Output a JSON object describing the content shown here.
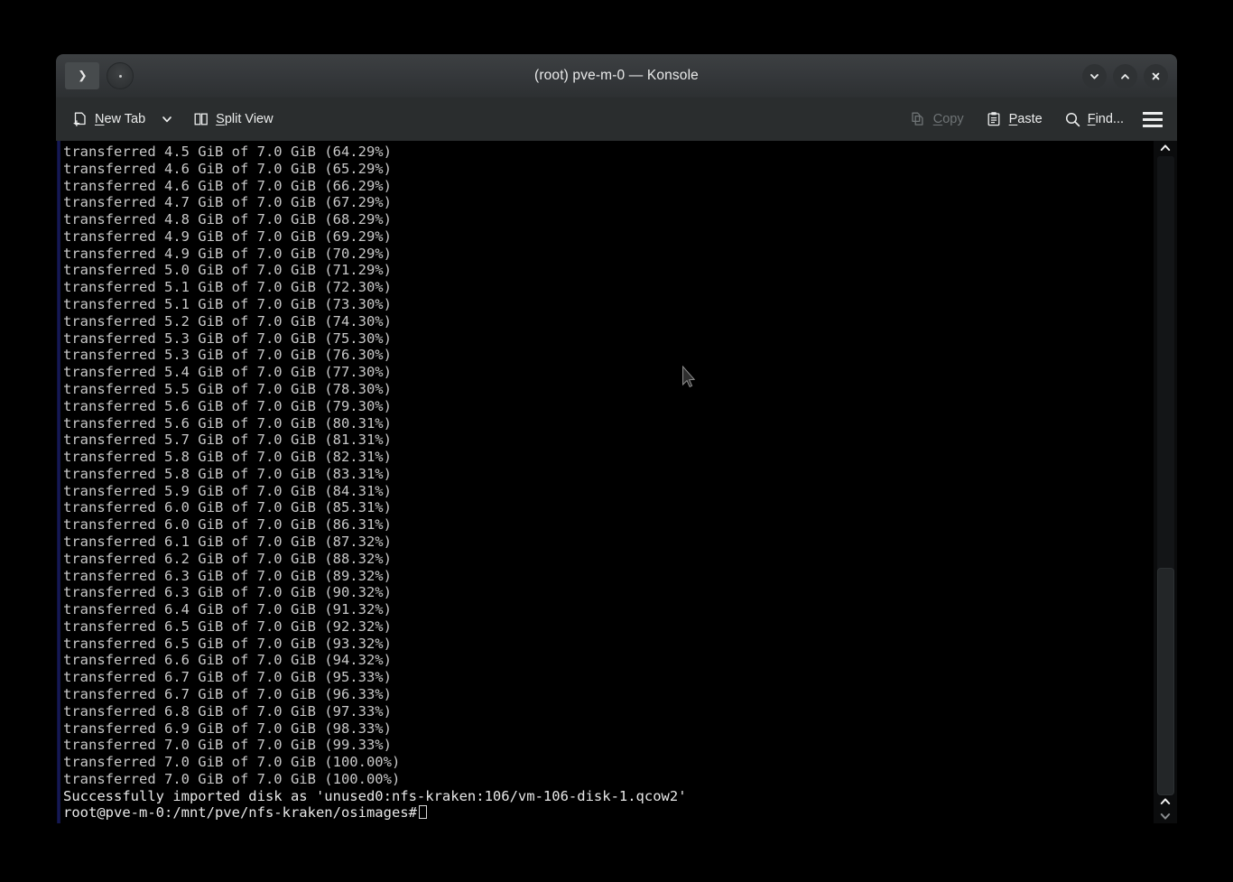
{
  "window": {
    "title": "(root) pve-m-0 — Konsole",
    "tab_icon": "terminal-prompt-icon",
    "new_tab_circle_icon": "new-tab-circle-icon",
    "controls": {
      "minimize": "chevron-down-icon",
      "maximize": "chevron-up-icon",
      "close": "close-icon"
    }
  },
  "toolbar": {
    "new_tab": {
      "label_pre": "",
      "label_u": "N",
      "label_post": "ew Tab",
      "icon": "new-tab-icon",
      "caret": "chevron-down-icon"
    },
    "split_view": {
      "label_u": "S",
      "label_post": "plit View",
      "icon": "split-view-icon"
    },
    "copy": {
      "label_u": "C",
      "label_post": "opy",
      "icon": "copy-icon",
      "disabled": true
    },
    "paste": {
      "label_u": "P",
      "label_post": "aste",
      "icon": "paste-icon",
      "disabled": false
    },
    "find": {
      "label_u": "F",
      "label_post": "ind...",
      "icon": "search-icon",
      "disabled": false
    },
    "menu": {
      "icon": "hamburger-menu-icon"
    }
  },
  "terminal": {
    "prompt": "root@pve-m-0:/mnt/pve/nfs-kraken/osimages#",
    "cursor": "block-cursor",
    "lines": [
      "transferred 4.5 GiB of 7.0 GiB (64.29%)",
      "transferred 4.6 GiB of 7.0 GiB (65.29%)",
      "transferred 4.6 GiB of 7.0 GiB (66.29%)",
      "transferred 4.7 GiB of 7.0 GiB (67.29%)",
      "transferred 4.8 GiB of 7.0 GiB (68.29%)",
      "transferred 4.9 GiB of 7.0 GiB (69.29%)",
      "transferred 4.9 GiB of 7.0 GiB (70.29%)",
      "transferred 5.0 GiB of 7.0 GiB (71.29%)",
      "transferred 5.1 GiB of 7.0 GiB (72.30%)",
      "transferred 5.1 GiB of 7.0 GiB (73.30%)",
      "transferred 5.2 GiB of 7.0 GiB (74.30%)",
      "transferred 5.3 GiB of 7.0 GiB (75.30%)",
      "transferred 5.3 GiB of 7.0 GiB (76.30%)",
      "transferred 5.4 GiB of 7.0 GiB (77.30%)",
      "transferred 5.5 GiB of 7.0 GiB (78.30%)",
      "transferred 5.6 GiB of 7.0 GiB (79.30%)",
      "transferred 5.6 GiB of 7.0 GiB (80.31%)",
      "transferred 5.7 GiB of 7.0 GiB (81.31%)",
      "transferred 5.8 GiB of 7.0 GiB (82.31%)",
      "transferred 5.8 GiB of 7.0 GiB (83.31%)",
      "transferred 5.9 GiB of 7.0 GiB (84.31%)",
      "transferred 6.0 GiB of 7.0 GiB (85.31%)",
      "transferred 6.0 GiB of 7.0 GiB (86.31%)",
      "transferred 6.1 GiB of 7.0 GiB (87.32%)",
      "transferred 6.2 GiB of 7.0 GiB (88.32%)",
      "transferred 6.3 GiB of 7.0 GiB (89.32%)",
      "transferred 6.3 GiB of 7.0 GiB (90.32%)",
      "transferred 6.4 GiB of 7.0 GiB (91.32%)",
      "transferred 6.5 GiB of 7.0 GiB (92.32%)",
      "transferred 6.5 GiB of 7.0 GiB (93.32%)",
      "transferred 6.6 GiB of 7.0 GiB (94.32%)",
      "transferred 6.7 GiB of 7.0 GiB (95.33%)",
      "transferred 6.7 GiB of 7.0 GiB (96.33%)",
      "transferred 6.8 GiB of 7.0 GiB (97.33%)",
      "transferred 6.9 GiB of 7.0 GiB (98.33%)",
      "transferred 7.0 GiB of 7.0 GiB (99.33%)",
      "transferred 7.0 GiB of 7.0 GiB (100.00%)",
      "transferred 7.0 GiB of 7.0 GiB (100.00%)"
    ],
    "result_line": "Successfully imported disk as 'unused0:nfs-kraken:106/vm-106-disk-1.qcow2'"
  },
  "scrollbar": {
    "top_arrow": "chevron-up-icon",
    "bottom_up_arrow": "chevron-up-icon",
    "bottom_down_arrow": "chevron-down-icon"
  },
  "colors": {
    "desktop_bg": "#000000",
    "titlebar": "#34373a",
    "toolbar": "#2a2d2e",
    "terminal_bg": "#000000",
    "terminal_fg": "#c8c8c8",
    "terminal_fg_bright": "#e8e8e8",
    "marker_blue": "#161a5c"
  }
}
